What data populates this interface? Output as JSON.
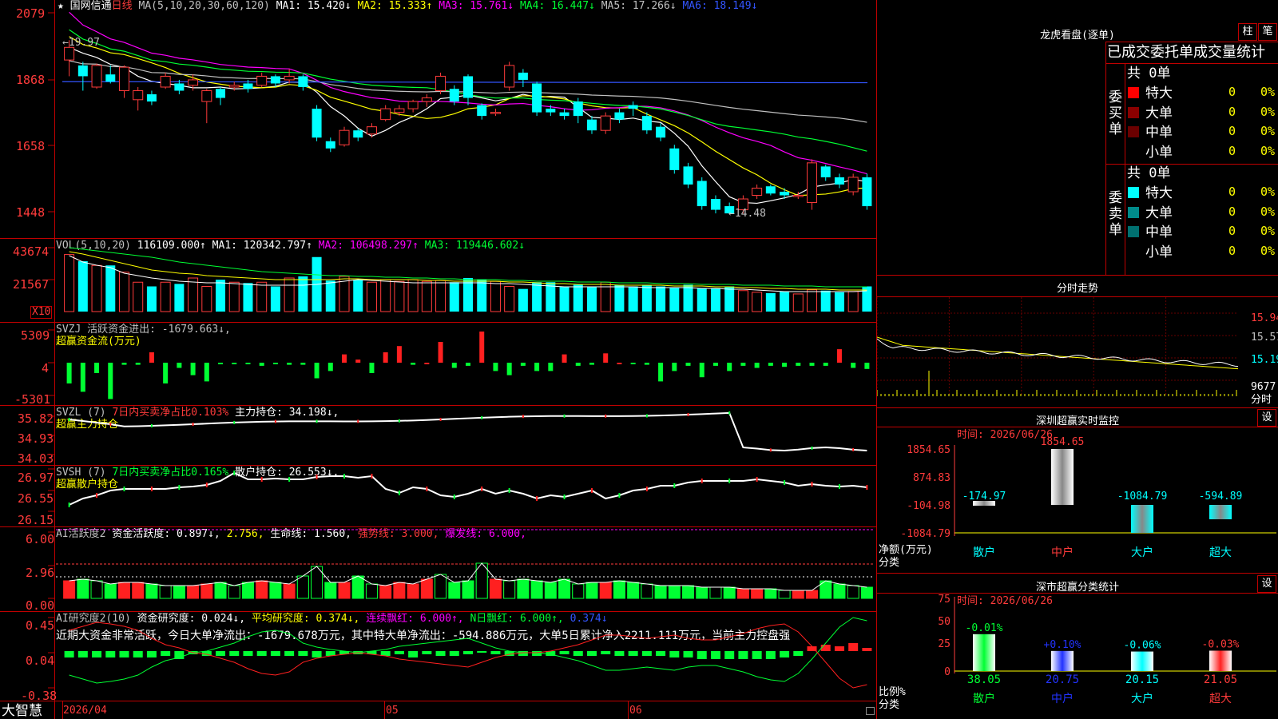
{
  "header": {
    "star": "★",
    "stock_name": "国网信通",
    "period": "日线",
    "ma_label": "MA(5,10,20,30,60,120)",
    "ma1": "MA1: 15.420↓",
    "ma2": "MA2: 15.333↑",
    "ma3": "MA3: 15.761↓",
    "ma4": "MA4: 16.447↓",
    "ma5": "MA5: 17.266↓",
    "ma6": "MA6: 18.149↓"
  },
  "price_axis": [
    "2079",
    "1868",
    "1658",
    "1448"
  ],
  "price_annotations": {
    "high": "←19.97",
    "low": "←14.48"
  },
  "vol": {
    "label": "VOL(5,10,20)",
    "value": "116109.000↑",
    "ma1": "MA1: 120342.797↑",
    "ma2": "MA2: 106498.297↑",
    "ma3": "MA3: 119446.602↓",
    "axis": [
      "43674",
      "21567"
    ],
    "unit": "X10"
  },
  "svzj": {
    "line1": "SVZJ  活跃资金进出: -1679.663↓,",
    "line2": "超赢资金流(万元)",
    "axis": [
      "5309",
      "4",
      "-5301"
    ]
  },
  "svzl": {
    "label": "SVZL (7)",
    "pct": "7日内买卖净占比0.103%",
    "hold": "主力持仓: 34.198↓,",
    "sub": "超赢主力持仓",
    "axis": [
      "35.82",
      "34.93",
      "34.03"
    ]
  },
  "svsh": {
    "label": "SVSH (7)",
    "pct": "7日内买卖净占比0.165%",
    "hold": "散户持仓: 26.553↓,",
    "sub": "超赢散户持仓",
    "axis": [
      "26.97",
      "26.55",
      "26.15"
    ]
  },
  "ai_active": {
    "label": "AI活跃度2",
    "v1": "资金活跃度: 0.897↓,",
    "v2": "2.756,",
    "v3": "生命线: 1.560,",
    "v4": "强势线: 3.000,",
    "v5": "爆发线: 6.000,",
    "axis": [
      "6.00",
      "2.96",
      "0.00"
    ]
  },
  "ai_research": {
    "label": "AI研究度2(10)",
    "v1": "资金研究度: 0.024↓,",
    "v2": "平均研究度: 0.374↓,",
    "v3": "连续飘红: 6.000↑,",
    "v4": "N日飘红: 6.000↑,",
    "v5": "0.374↓",
    "comment": "近期大资金非常活跃，今日大单净流出：-1679.678万元，其中特大单净流出：-594.886万元，大单5日累计净入2211.111万元，当前主力控盘强",
    "axis": [
      "0.45",
      "0.04",
      "-0.38"
    ]
  },
  "bottom": {
    "brand": "大智慧",
    "date_start": "2026/04",
    "month2": "05",
    "month3": "06"
  },
  "dragon": {
    "title": "龙虎看盘(逐单)",
    "btn_bar": "柱",
    "btn_detail": "笔",
    "subtitle": "已成交委托单成交量统计",
    "buy_label": "委买单",
    "buy_total": "共 0单",
    "sell_label": "委卖单",
    "sell_total": "共 0单",
    "buy_rows": [
      {
        "name": "特大",
        "qty": "0",
        "pct": "0%",
        "color": "#ff0000"
      },
      {
        "name": "大单",
        "qty": "0",
        "pct": "0%",
        "color": "#8b0000"
      },
      {
        "name": "中单",
        "qty": "0",
        "pct": "0%",
        "color": "#6b0000"
      },
      {
        "name": "小单",
        "qty": "0",
        "pct": "0%",
        "color": "#000000"
      }
    ],
    "sell_rows": [
      {
        "name": "特大",
        "qty": "0",
        "pct": "0%",
        "color": "#00ffff"
      },
      {
        "name": "大单",
        "qty": "0",
        "pct": "0%",
        "color": "#008b8b"
      },
      {
        "name": "中单",
        "qty": "0",
        "pct": "0%",
        "color": "#007070"
      },
      {
        "name": "小单",
        "qty": "0",
        "pct": "0%",
        "color": "#000000"
      }
    ]
  },
  "intraday": {
    "title": "分时走势",
    "axis": [
      "15.94",
      "15.57",
      "15.19"
    ],
    "vol_label": "9677",
    "unit": "分时"
  },
  "monitor": {
    "title": "深圳超赢实时监控",
    "btn": "设",
    "time": "时间: 2026/06/26",
    "axis": [
      "1854.65",
      "874.83",
      "-104.98",
      "-1084.79"
    ],
    "ylabel": "净额(万元)",
    "xlabel": "分类",
    "bars": [
      {
        "cat": "散户",
        "value": "-174.97"
      },
      {
        "cat": "中户",
        "value": "1854.65"
      },
      {
        "cat": "大户",
        "value": "-1084.79"
      },
      {
        "cat": "超大",
        "value": "-594.89"
      }
    ]
  },
  "classify": {
    "title": "深市超赢分类统计",
    "btn": "设",
    "time": "时间: 2026/06/26",
    "axis": [
      "75",
      "50",
      "25",
      "0"
    ],
    "ylabel": "比例%",
    "xlabel": "分类",
    "bars": [
      {
        "cat": "散户",
        "value": "38.05",
        "change": "-0.01%"
      },
      {
        "cat": "中户",
        "value": "20.75",
        "change": "+0.10%"
      },
      {
        "cat": "大户",
        "value": "20.15",
        "change": "-0.06%"
      },
      {
        "cat": "超大",
        "value": "21.05",
        "change": "-0.03%"
      }
    ]
  },
  "chart_data": {
    "type": "candlestick",
    "price_range": [
      14.48,
      19.97
    ],
    "candles": [
      [
        18.75,
        19.1,
        18.3,
        19.3
      ],
      [
        18.6,
        18.3,
        17.9,
        18.7
      ],
      [
        18.0,
        18.6,
        17.95,
        18.65
      ],
      [
        18.35,
        18.15,
        18.1,
        18.6
      ],
      [
        17.9,
        18.55,
        17.7,
        18.6
      ],
      [
        17.65,
        17.9,
        17.35,
        18.0
      ],
      [
        17.8,
        17.6,
        17.5,
        17.9
      ],
      [
        18.0,
        18.3,
        17.95,
        18.4
      ],
      [
        18.1,
        17.9,
        17.8,
        18.2
      ],
      [
        18.05,
        18.2,
        17.9,
        18.35
      ],
      [
        17.6,
        17.9,
        17.0,
        17.95
      ],
      [
        17.95,
        17.7,
        17.5,
        18.0
      ],
      [
        18.0,
        18.05,
        17.9,
        18.15
      ],
      [
        18.1,
        17.95,
        17.85,
        18.2
      ],
      [
        18.05,
        18.3,
        18.0,
        18.4
      ],
      [
        18.3,
        18.1,
        18.0,
        18.35
      ],
      [
        18.2,
        18.3,
        18.1,
        18.5
      ],
      [
        18.3,
        18.0,
        17.9,
        18.35
      ],
      [
        17.4,
        16.6,
        16.5,
        17.5
      ],
      [
        16.5,
        16.3,
        16.2,
        16.6
      ],
      [
        16.4,
        16.8,
        16.35,
        16.9
      ],
      [
        16.8,
        16.6,
        16.5,
        16.85
      ],
      [
        16.7,
        16.9,
        16.6,
        17.0
      ],
      [
        17.1,
        17.4,
        17.05,
        17.5
      ],
      [
        17.3,
        17.4,
        17.2,
        17.5
      ],
      [
        17.4,
        17.6,
        17.3,
        17.65
      ],
      [
        17.6,
        17.7,
        17.45,
        17.8
      ],
      [
        17.9,
        18.3,
        17.8,
        18.4
      ],
      [
        17.95,
        17.6,
        17.5,
        18.05
      ],
      [
        18.3,
        17.7,
        17.5,
        18.35
      ],
      [
        17.5,
        17.2,
        17.1,
        17.55
      ],
      [
        17.3,
        17.3,
        17.2,
        17.4
      ],
      [
        18.0,
        18.6,
        17.9,
        18.7
      ],
      [
        18.4,
        18.2,
        18.0,
        18.5
      ],
      [
        18.1,
        17.3,
        17.2,
        18.15
      ],
      [
        17.4,
        17.3,
        17.2,
        17.5
      ],
      [
        17.3,
        17.2,
        17.1,
        17.4
      ],
      [
        17.6,
        17.2,
        17.0,
        17.7
      ],
      [
        17.1,
        16.8,
        16.7,
        17.2
      ],
      [
        16.8,
        17.2,
        16.7,
        17.3
      ],
      [
        17.3,
        17.1,
        17.0,
        17.4
      ],
      [
        17.5,
        17.4,
        17.2,
        17.6
      ],
      [
        17.2,
        16.8,
        16.7,
        17.3
      ],
      [
        16.9,
        16.6,
        16.5,
        17.0
      ],
      [
        16.3,
        15.7,
        15.6,
        16.4
      ],
      [
        15.8,
        15.3,
        15.2,
        15.9
      ],
      [
        15.4,
        14.7,
        14.6,
        15.5
      ],
      [
        14.9,
        14.6,
        14.5,
        15.0
      ],
      [
        14.7,
        14.5,
        14.48,
        14.8
      ],
      [
        14.6,
        14.9,
        14.5,
        15.0
      ],
      [
        15.0,
        15.2,
        14.9,
        15.3
      ],
      [
        15.25,
        15.05,
        15.0,
        15.3
      ],
      [
        15.1,
        15.0,
        14.9,
        15.2
      ],
      [
        15.0,
        15.0,
        14.9,
        15.1
      ],
      [
        14.8,
        15.9,
        14.6,
        16.0
      ],
      [
        15.8,
        15.5,
        15.4,
        15.85
      ],
      [
        15.5,
        15.3,
        15.2,
        15.6
      ],
      [
        15.1,
        15.5,
        15.0,
        15.6
      ],
      [
        15.5,
        14.7,
        14.6,
        15.6
      ]
    ],
    "volume": [
      68,
      60,
      55,
      55,
      47,
      35,
      30,
      35,
      33,
      40,
      30,
      38,
      35,
      34,
      35,
      30,
      40,
      42,
      65,
      37,
      42,
      38,
      35,
      38,
      36,
      38,
      36,
      37,
      35,
      40,
      38,
      36,
      30,
      27,
      35,
      35,
      30,
      32,
      30,
      35,
      32,
      30,
      32,
      30,
      28,
      32,
      28,
      28,
      30,
      25,
      23,
      22,
      24,
      21,
      26,
      25,
      23,
      24,
      30
    ]
  }
}
